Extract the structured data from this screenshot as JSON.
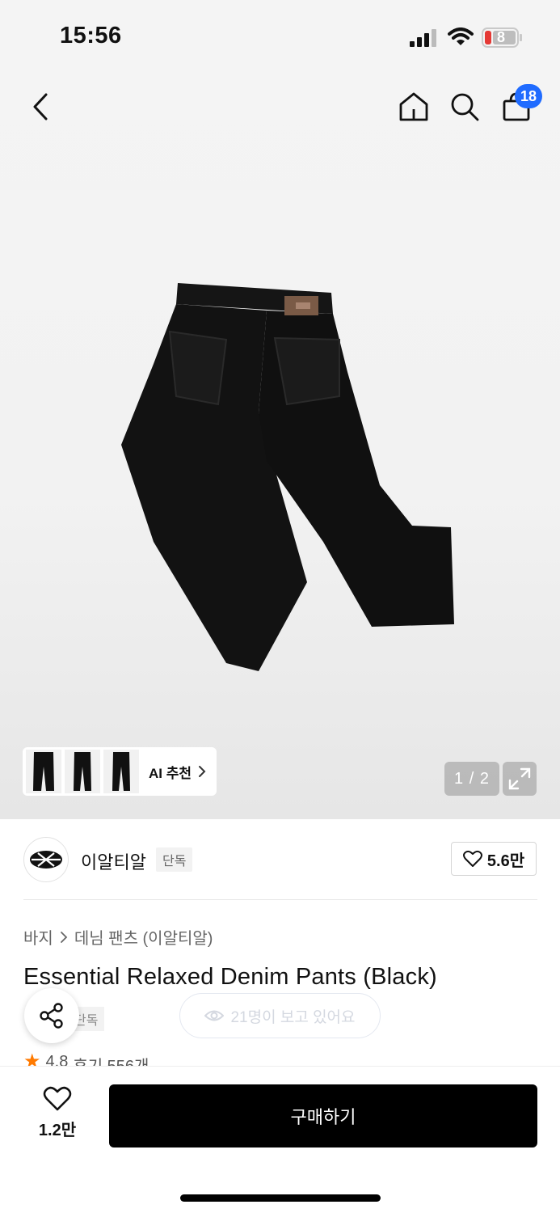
{
  "status_bar": {
    "time": "15:56",
    "battery": "8"
  },
  "nav": {
    "cart_count": "18"
  },
  "gallery": {
    "ai_label": "AI 추천",
    "page_indicator": "1 / 2"
  },
  "brand": {
    "name": "이알티알",
    "tag": "단독",
    "like_count": "5.6만"
  },
  "breadcrumb": {
    "category": "바지",
    "subcategory": "데님 팬츠 (이알티알)"
  },
  "product": {
    "title": "Essential Relaxed Denim Pants (Black)",
    "exclusive_tag": "단독",
    "viewers": "21명이 보고 있어요",
    "rating": "4.8",
    "reviews": "후기 556개"
  },
  "bottom": {
    "wish_count": "1.2만",
    "buy_label": "구매하기"
  },
  "colors": {
    "accent_badge": "#1f6bff",
    "star": "#ff7a00",
    "battery_low": "#e53935"
  }
}
